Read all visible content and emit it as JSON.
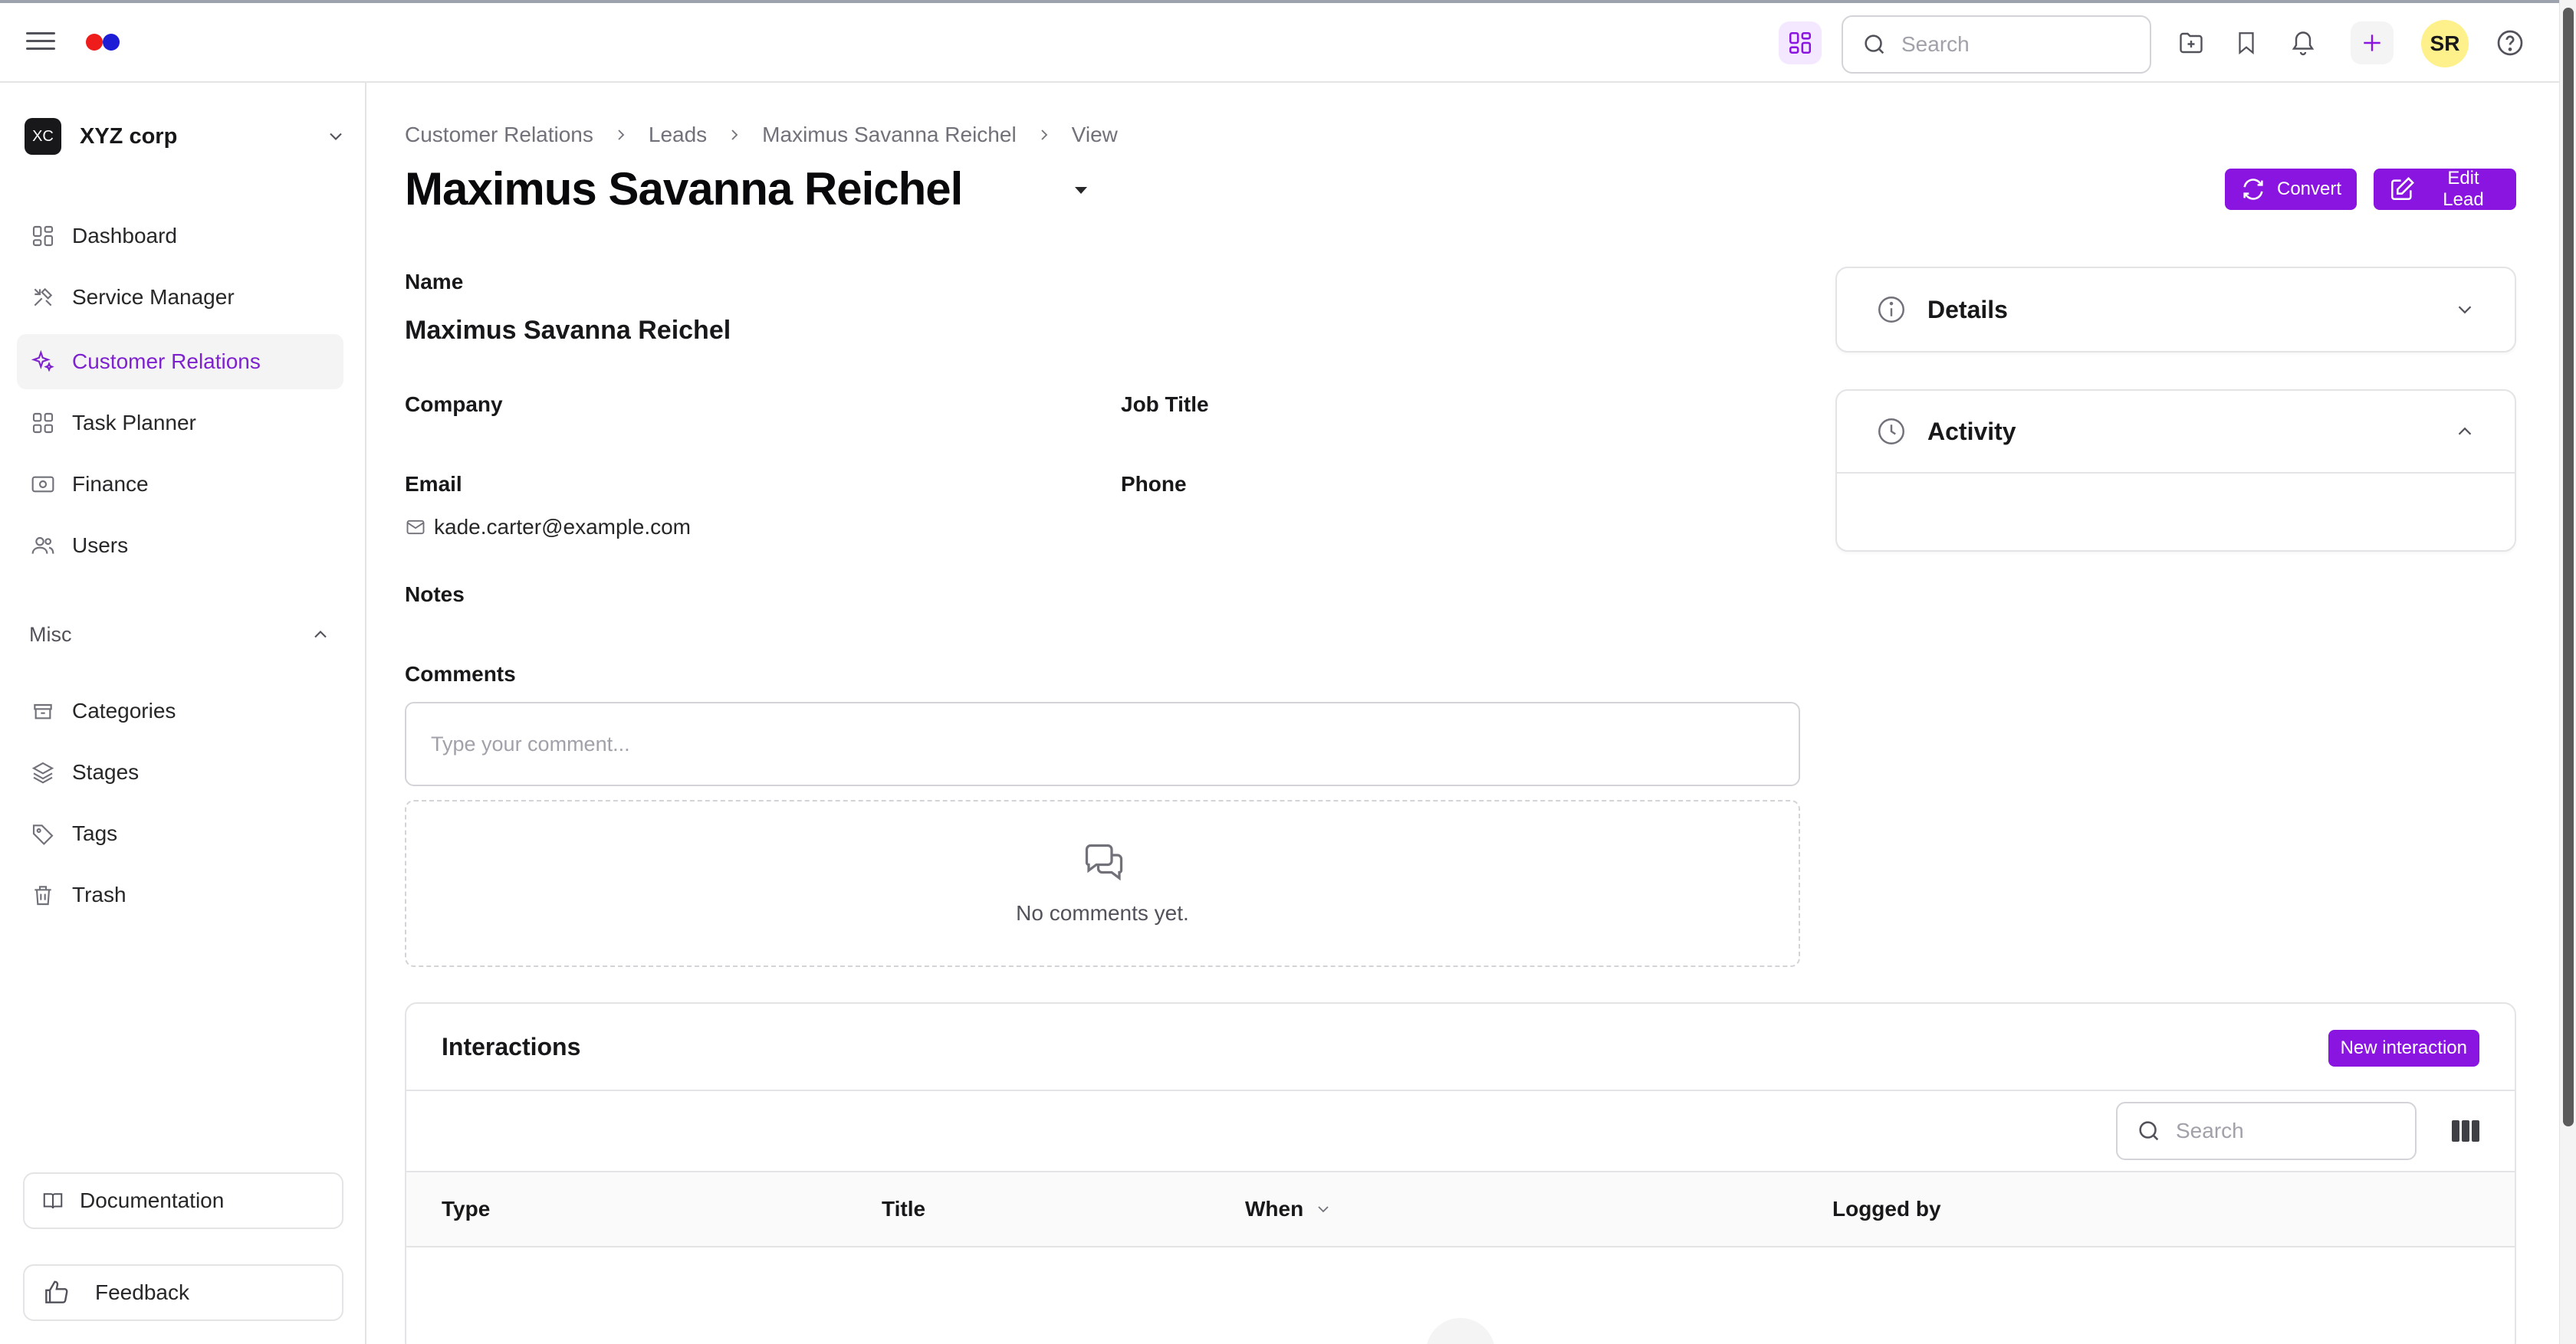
{
  "topbar": {
    "search_placeholder": "Search",
    "avatar_initials": "SR",
    "icons": [
      "menu-icon",
      "apps-grid-icon",
      "search-icon",
      "folder-plus-icon",
      "bookmark-icon",
      "bell-icon",
      "plus-icon",
      "help-icon"
    ]
  },
  "sidebar": {
    "org_badge": "XC",
    "org_name": "XYZ corp",
    "items": [
      {
        "label": "Dashboard",
        "icon": "dashboard-icon"
      },
      {
        "label": "Service Manager",
        "icon": "tools-icon"
      },
      {
        "label": "Customer Relations",
        "icon": "sparkles-icon",
        "active": true
      },
      {
        "label": "Task Planner",
        "icon": "grid-icon"
      },
      {
        "label": "Finance",
        "icon": "money-icon"
      },
      {
        "label": "Users",
        "icon": "users-icon"
      }
    ],
    "misc_label": "Misc",
    "misc_items": [
      {
        "label": "Categories",
        "icon": "archive-icon"
      },
      {
        "label": "Stages",
        "icon": "layers-icon"
      },
      {
        "label": "Tags",
        "icon": "tag-icon"
      },
      {
        "label": "Trash",
        "icon": "trash-icon"
      }
    ],
    "documentation_label": "Documentation",
    "feedback_label": "Feedback"
  },
  "breadcrumb": [
    "Customer Relations",
    "Leads",
    "Maximus Savanna Reichel",
    "View"
  ],
  "page_title": "Maximus Savanna Reichel",
  "actions": {
    "convert_label": "Convert",
    "edit_label": "Edit Lead"
  },
  "lead": {
    "name_label": "Name",
    "name_value": "Maximus Savanna Reichel",
    "company_label": "Company",
    "job_title_label": "Job Title",
    "email_label": "Email",
    "email_value": "kade.carter@example.com",
    "phone_label": "Phone",
    "notes_label": "Notes"
  },
  "comments": {
    "label": "Comments",
    "placeholder": "Type your comment...",
    "empty_text": "No comments yet."
  },
  "panels": {
    "details_title": "Details",
    "activity_title": "Activity"
  },
  "interactions": {
    "title": "Interactions",
    "new_button": "New interaction",
    "search_placeholder": "Search",
    "columns": [
      "Type",
      "Title",
      "When",
      "Logged by"
    ]
  },
  "colors": {
    "accent": "#8a14e0",
    "active_nav_text": "#7e22ce",
    "avatar_bg": "#fef08a"
  }
}
